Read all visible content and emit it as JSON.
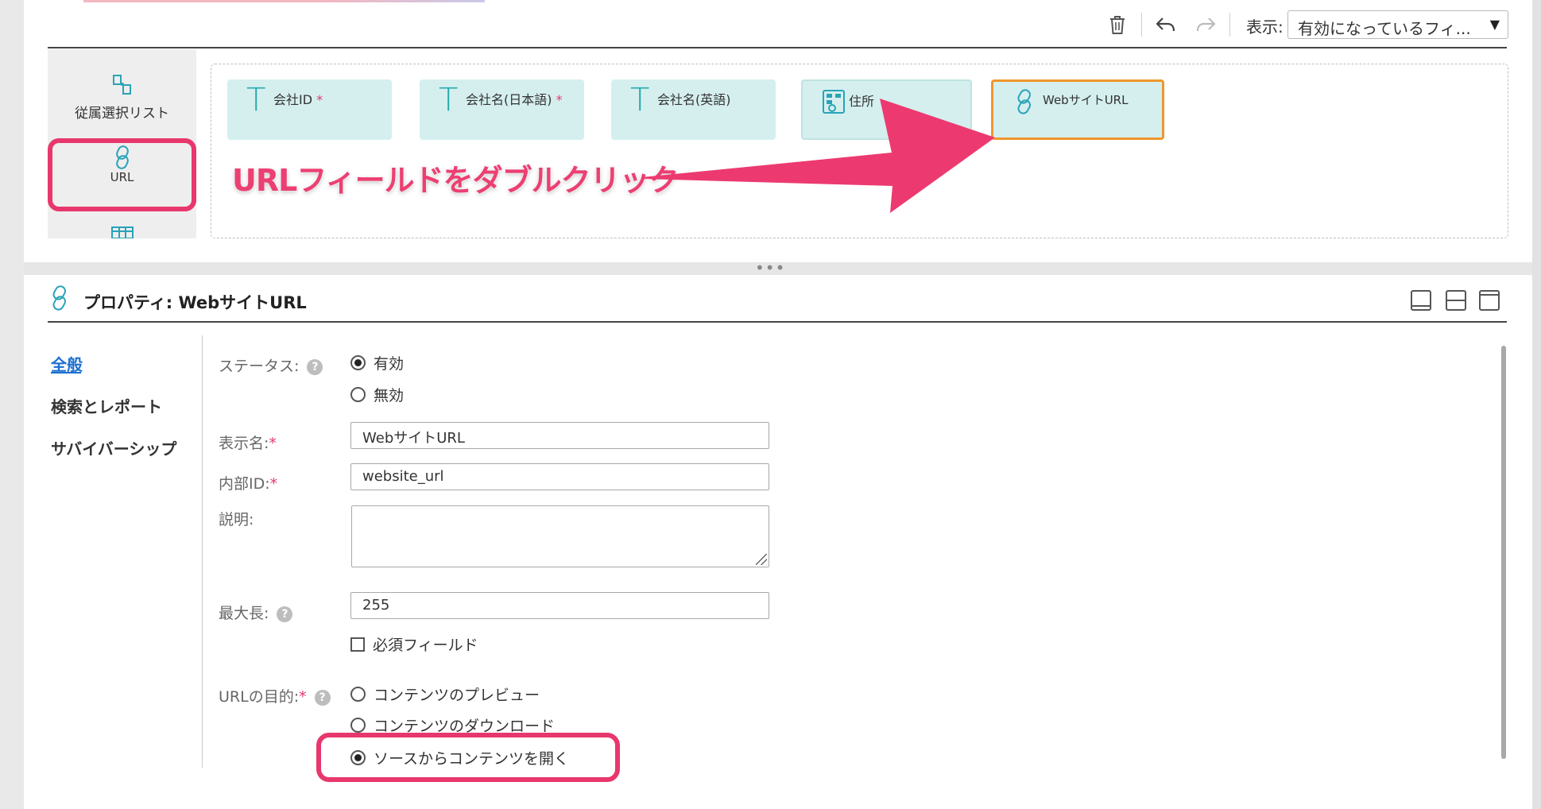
{
  "toolbar": {
    "icons": [
      "trash-icon",
      "undo-icon",
      "redo-icon"
    ],
    "view_label": "表示:",
    "view_select_value": "有効になっているフィ..."
  },
  "palette": {
    "items": [
      {
        "label": "従属選択リスト",
        "icon": "dependent-picklist-icon"
      },
      {
        "label": "URL",
        "icon": "link-icon"
      },
      {
        "label": "",
        "icon": "table-icon"
      }
    ]
  },
  "canvas": {
    "fields": [
      {
        "label": "会社ID",
        "required": "*",
        "icon_glyph": "T"
      },
      {
        "label": "会社名(日本語)",
        "required": "*",
        "icon_glyph": "T"
      },
      {
        "label": "会社名(英語)",
        "required": "",
        "icon_glyph": "T"
      },
      {
        "label": "住所",
        "required": "",
        "icon": "address-icon"
      },
      {
        "label": "WebサイトURL",
        "required": "",
        "icon": "link-icon"
      }
    ]
  },
  "annotation": {
    "text": "URLフィールドをダブルクリック",
    "color": "#e8376d"
  },
  "properties": {
    "title": "プロパティ: WebサイトURL",
    "tabs": [
      "全般",
      "検索とレポート",
      "サバイバーシップ"
    ],
    "status_label": "ステータス:",
    "status_options": [
      "有効",
      "無効"
    ],
    "display_name_label": "表示名:",
    "display_name_value": "WebサイトURL",
    "internal_id_label": "内部ID:",
    "internal_id_value": "website_url",
    "description_label": "説明:",
    "max_length_label": "最大長:",
    "max_length_value": "255",
    "required_field_label": "必須フィールド",
    "url_purpose_label": "URLの目的:",
    "url_purpose_options": [
      "コンテンツのプレビュー",
      "コンテンツのダウンロード",
      "ソースからコンテンツを開く"
    ],
    "required_marker": "*",
    "help_glyph": "?"
  }
}
